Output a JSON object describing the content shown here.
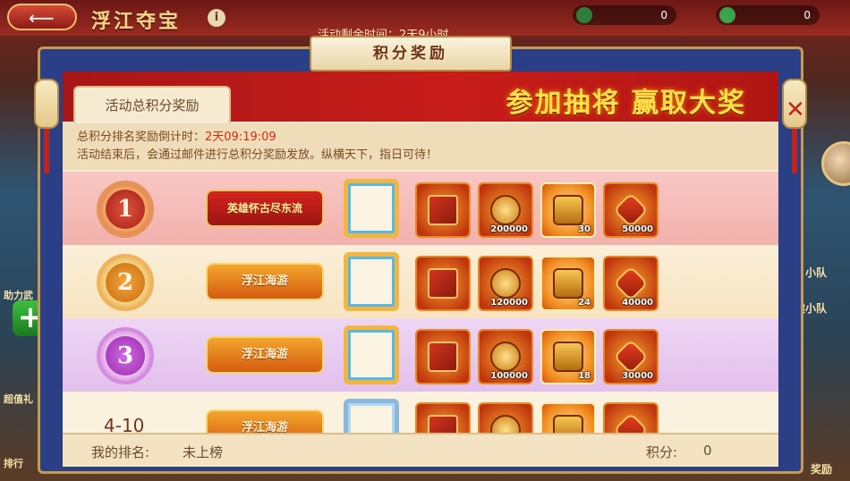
{
  "background": {
    "back_icon": "back-arrow-icon",
    "title": "浮江夺宝",
    "info_icon": "info-icon",
    "countdown_label": "活动剩余时间：2天9小时",
    "resource1_value": "0",
    "resource2_value": "0",
    "left_labels": [
      "助力武",
      "超值礼",
      "排行"
    ],
    "right_labels": [
      "小队",
      "创建小队"
    ],
    "right_bottom_label": "奖励"
  },
  "modal": {
    "title": "积分奖励",
    "banner_text": "参加抽将  赢取大奖",
    "tab_label": "活动总积分奖励",
    "notice_countdown_label": "总积分排名奖励倒计时：",
    "notice_countdown_value": "2天09:19:09",
    "notice_line2": "活动结束后，会通过邮件进行总积分奖励发放。纵横天下，指日可待！",
    "close_icon": "close-icon"
  },
  "rows": [
    {
      "rank": "1",
      "title": "英雄怀古尽东流",
      "items": [
        {
          "icon": "red-card-pack-icon",
          "count": ""
        },
        {
          "icon": "gold-coin-icon",
          "count": "200000"
        },
        {
          "icon": "treasure-chest-icon",
          "count": "30"
        },
        {
          "icon": "red-gem-icon",
          "count": "50000"
        }
      ]
    },
    {
      "rank": "2",
      "title": "浮江海游",
      "items": [
        {
          "icon": "red-card-pack-icon",
          "count": ""
        },
        {
          "icon": "gold-coin-icon",
          "count": "120000"
        },
        {
          "icon": "treasure-chest-icon",
          "count": "24"
        },
        {
          "icon": "red-gem-icon",
          "count": "40000"
        }
      ]
    },
    {
      "rank": "3",
      "title": "浮江海游",
      "items": [
        {
          "icon": "red-card-pack-icon",
          "count": ""
        },
        {
          "icon": "gold-coin-icon",
          "count": "100000"
        },
        {
          "icon": "treasure-chest-icon",
          "count": "18"
        },
        {
          "icon": "red-gem-icon",
          "count": "30000"
        }
      ]
    },
    {
      "rank": "4-10",
      "title": "浮江海游",
      "items": [
        {
          "icon": "red-card-pack-icon",
          "count": ""
        },
        {
          "icon": "gold-coin-icon",
          "count": ""
        },
        {
          "icon": "treasure-chest-icon",
          "count": ""
        },
        {
          "icon": "red-gem-icon",
          "count": ""
        }
      ]
    }
  ],
  "footer": {
    "my_rank_label": "我的排名:",
    "my_rank_value": "未上榜",
    "score_label": "积分:",
    "score_value": "0"
  }
}
